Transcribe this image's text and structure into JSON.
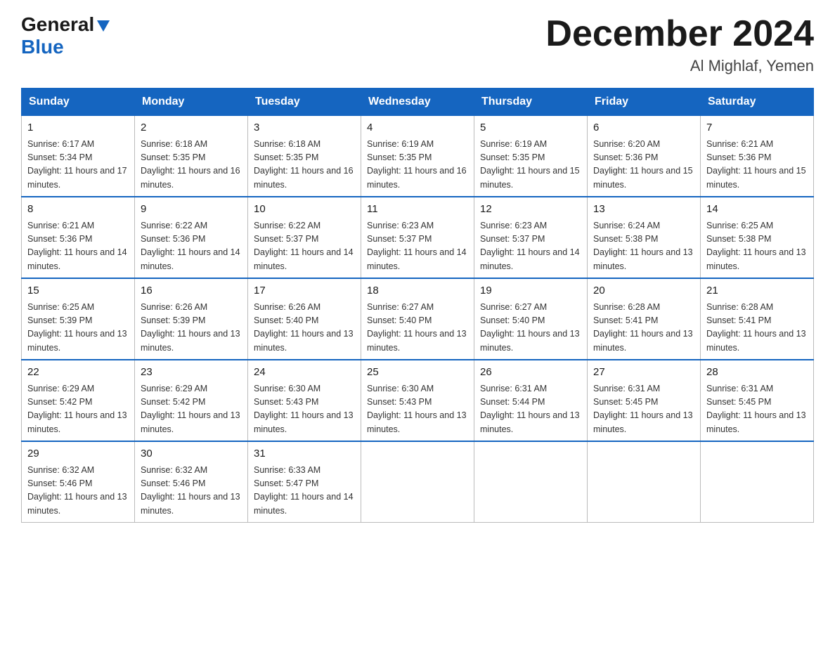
{
  "logo": {
    "general": "General",
    "blue": "Blue"
  },
  "title": "December 2024",
  "subtitle": "Al Mighlaf, Yemen",
  "days": [
    "Sunday",
    "Monday",
    "Tuesday",
    "Wednesday",
    "Thursday",
    "Friday",
    "Saturday"
  ],
  "weeks": [
    [
      {
        "num": "1",
        "sunrise": "6:17 AM",
        "sunset": "5:34 PM",
        "daylight": "11 hours and 17 minutes."
      },
      {
        "num": "2",
        "sunrise": "6:18 AM",
        "sunset": "5:35 PM",
        "daylight": "11 hours and 16 minutes."
      },
      {
        "num": "3",
        "sunrise": "6:18 AM",
        "sunset": "5:35 PM",
        "daylight": "11 hours and 16 minutes."
      },
      {
        "num": "4",
        "sunrise": "6:19 AM",
        "sunset": "5:35 PM",
        "daylight": "11 hours and 16 minutes."
      },
      {
        "num": "5",
        "sunrise": "6:19 AM",
        "sunset": "5:35 PM",
        "daylight": "11 hours and 15 minutes."
      },
      {
        "num": "6",
        "sunrise": "6:20 AM",
        "sunset": "5:36 PM",
        "daylight": "11 hours and 15 minutes."
      },
      {
        "num": "7",
        "sunrise": "6:21 AM",
        "sunset": "5:36 PM",
        "daylight": "11 hours and 15 minutes."
      }
    ],
    [
      {
        "num": "8",
        "sunrise": "6:21 AM",
        "sunset": "5:36 PM",
        "daylight": "11 hours and 14 minutes."
      },
      {
        "num": "9",
        "sunrise": "6:22 AM",
        "sunset": "5:36 PM",
        "daylight": "11 hours and 14 minutes."
      },
      {
        "num": "10",
        "sunrise": "6:22 AM",
        "sunset": "5:37 PM",
        "daylight": "11 hours and 14 minutes."
      },
      {
        "num": "11",
        "sunrise": "6:23 AM",
        "sunset": "5:37 PM",
        "daylight": "11 hours and 14 minutes."
      },
      {
        "num": "12",
        "sunrise": "6:23 AM",
        "sunset": "5:37 PM",
        "daylight": "11 hours and 14 minutes."
      },
      {
        "num": "13",
        "sunrise": "6:24 AM",
        "sunset": "5:38 PM",
        "daylight": "11 hours and 13 minutes."
      },
      {
        "num": "14",
        "sunrise": "6:25 AM",
        "sunset": "5:38 PM",
        "daylight": "11 hours and 13 minutes."
      }
    ],
    [
      {
        "num": "15",
        "sunrise": "6:25 AM",
        "sunset": "5:39 PM",
        "daylight": "11 hours and 13 minutes."
      },
      {
        "num": "16",
        "sunrise": "6:26 AM",
        "sunset": "5:39 PM",
        "daylight": "11 hours and 13 minutes."
      },
      {
        "num": "17",
        "sunrise": "6:26 AM",
        "sunset": "5:40 PM",
        "daylight": "11 hours and 13 minutes."
      },
      {
        "num": "18",
        "sunrise": "6:27 AM",
        "sunset": "5:40 PM",
        "daylight": "11 hours and 13 minutes."
      },
      {
        "num": "19",
        "sunrise": "6:27 AM",
        "sunset": "5:40 PM",
        "daylight": "11 hours and 13 minutes."
      },
      {
        "num": "20",
        "sunrise": "6:28 AM",
        "sunset": "5:41 PM",
        "daylight": "11 hours and 13 minutes."
      },
      {
        "num": "21",
        "sunrise": "6:28 AM",
        "sunset": "5:41 PM",
        "daylight": "11 hours and 13 minutes."
      }
    ],
    [
      {
        "num": "22",
        "sunrise": "6:29 AM",
        "sunset": "5:42 PM",
        "daylight": "11 hours and 13 minutes."
      },
      {
        "num": "23",
        "sunrise": "6:29 AM",
        "sunset": "5:42 PM",
        "daylight": "11 hours and 13 minutes."
      },
      {
        "num": "24",
        "sunrise": "6:30 AM",
        "sunset": "5:43 PM",
        "daylight": "11 hours and 13 minutes."
      },
      {
        "num": "25",
        "sunrise": "6:30 AM",
        "sunset": "5:43 PM",
        "daylight": "11 hours and 13 minutes."
      },
      {
        "num": "26",
        "sunrise": "6:31 AM",
        "sunset": "5:44 PM",
        "daylight": "11 hours and 13 minutes."
      },
      {
        "num": "27",
        "sunrise": "6:31 AM",
        "sunset": "5:45 PM",
        "daylight": "11 hours and 13 minutes."
      },
      {
        "num": "28",
        "sunrise": "6:31 AM",
        "sunset": "5:45 PM",
        "daylight": "11 hours and 13 minutes."
      }
    ],
    [
      {
        "num": "29",
        "sunrise": "6:32 AM",
        "sunset": "5:46 PM",
        "daylight": "11 hours and 13 minutes."
      },
      {
        "num": "30",
        "sunrise": "6:32 AM",
        "sunset": "5:46 PM",
        "daylight": "11 hours and 13 minutes."
      },
      {
        "num": "31",
        "sunrise": "6:33 AM",
        "sunset": "5:47 PM",
        "daylight": "11 hours and 14 minutes."
      },
      null,
      null,
      null,
      null
    ]
  ]
}
